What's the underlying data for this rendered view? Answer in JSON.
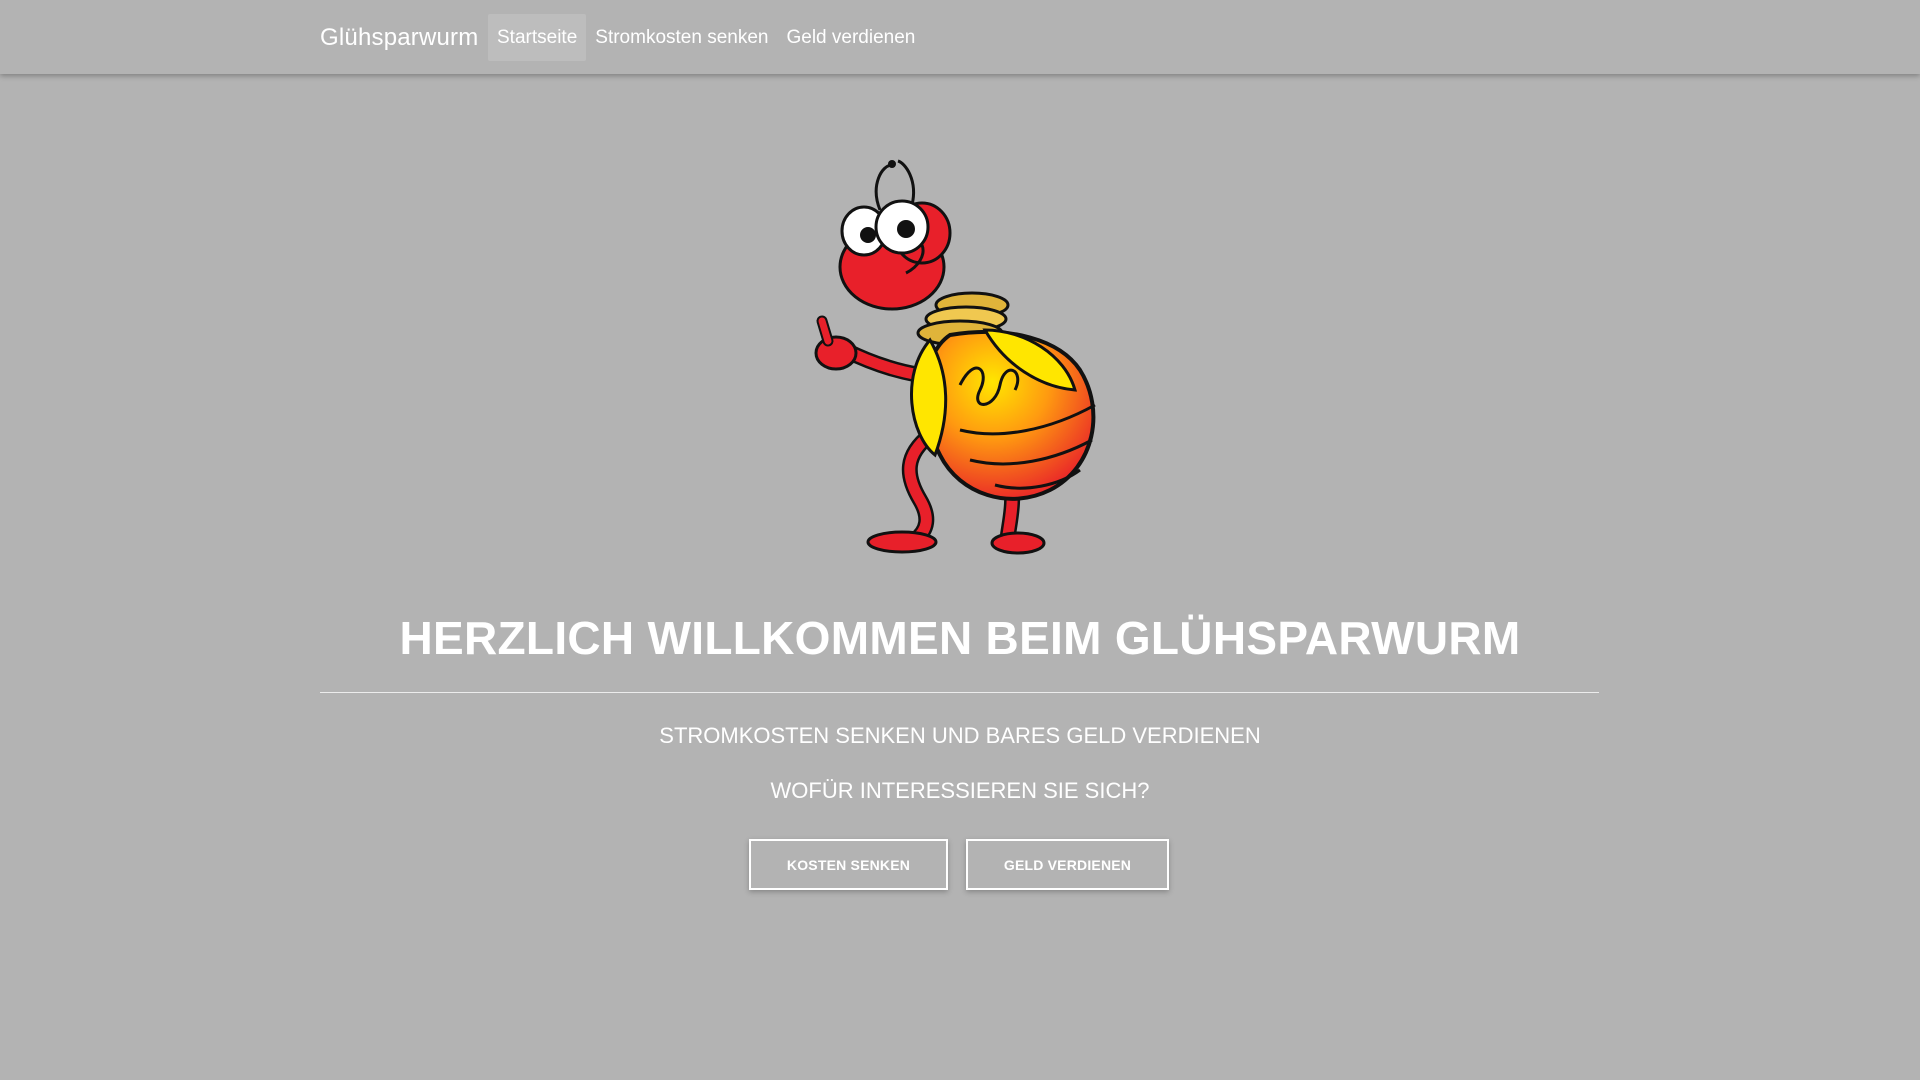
{
  "navbar": {
    "brand": "Glühsparwurm",
    "links": [
      {
        "label": "Startseite",
        "active": true
      },
      {
        "label": "Stromkosten senken",
        "active": false
      },
      {
        "label": "Geld verdienen",
        "active": false
      }
    ]
  },
  "hero": {
    "mascot_icon": "lightbulb-worm-mascot",
    "title": "HERZLICH WILLKOMMEN BEIM GLÜHSPARWURM",
    "subtitle": "STROMKOSTEN SENKEN UND BARES GELD VERDIENEN",
    "question": "WOFÜR INTERESSIEREN SIE SICH?",
    "buttons": {
      "kosten_label": "KOSTEN SENKEN",
      "geld_label": "GELD VERDIENEN"
    }
  },
  "colors": {
    "background": "#b3b3b3",
    "text": "#ffffff",
    "mascot_red": "#e8202a",
    "mascot_yellow": "#ffe600",
    "mascot_orange": "#ff7a10"
  }
}
